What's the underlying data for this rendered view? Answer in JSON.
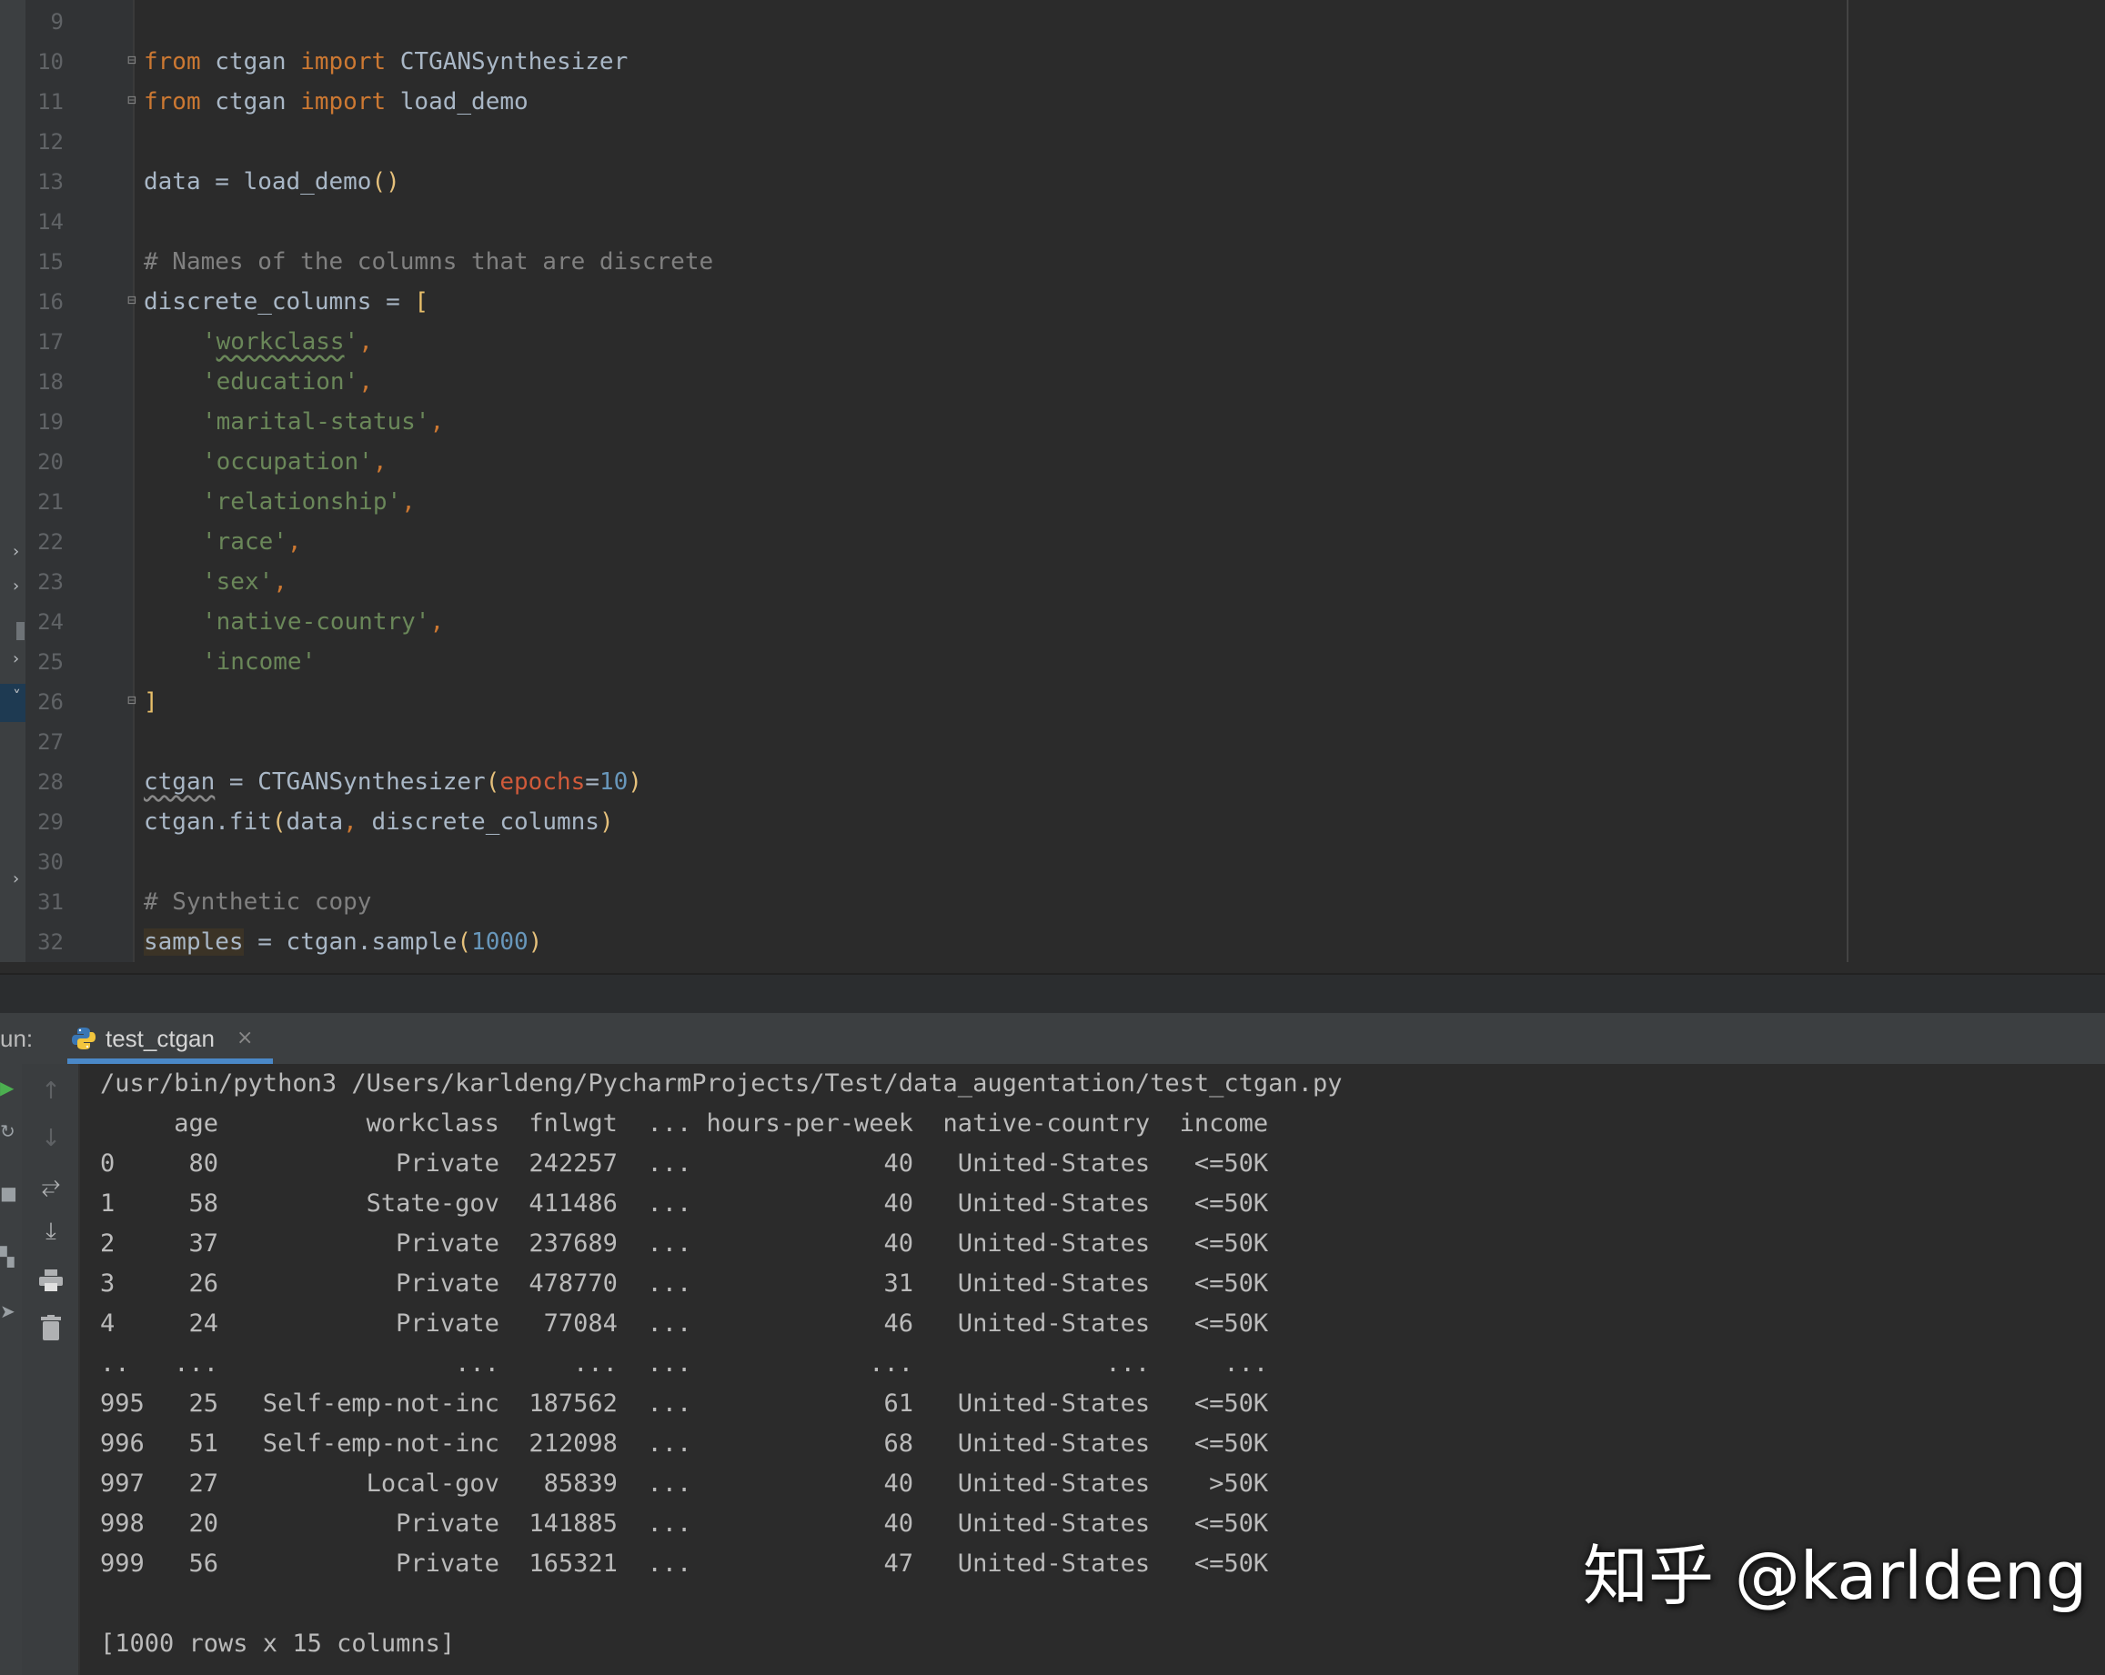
{
  "editor": {
    "line_numbers": [
      "9",
      "10",
      "11",
      "12",
      "13",
      "14",
      "15",
      "16",
      "17",
      "18",
      "19",
      "20",
      "21",
      "22",
      "23",
      "24",
      "25",
      "26",
      "27",
      "28",
      "29",
      "30",
      "31",
      "32"
    ],
    "lines": {
      "l10": {
        "kw1": "from",
        "mid1": " ctgan ",
        "kw2": "import",
        "rest": " CTGANSynthesizer"
      },
      "l11": {
        "kw1": "from",
        "mid1": " ctgan ",
        "kw2": "import",
        "rest": " load_demo"
      },
      "l13": {
        "text": "data = load_demo",
        "paren": "()"
      },
      "l15": {
        "comment": "# Names of the columns that are discrete"
      },
      "l16": {
        "text": "discrete_columns = ",
        "bracket": "["
      },
      "l17": {
        "q1": "'",
        "word": "workclass",
        "q2": "'",
        "comma": ","
      },
      "l18": {
        "str": "'education'",
        "comma": ","
      },
      "l19": {
        "str": "'marital-status'",
        "comma": ","
      },
      "l20": {
        "str": "'occupation'",
        "comma": ","
      },
      "l21": {
        "str": "'relationship'",
        "comma": ","
      },
      "l22": {
        "str": "'race'",
        "comma": ","
      },
      "l23": {
        "str": "'sex'",
        "comma": ","
      },
      "l24": {
        "str": "'native-country'",
        "comma": ","
      },
      "l25": {
        "str": "'income'"
      },
      "l26": {
        "bracket": "]"
      },
      "l28": {
        "var": "ctgan",
        "mid": " = CTGANSynthesizer",
        "p1": "(",
        "param": "epochs",
        "eq": "=",
        "num": "10",
        "p2": ")"
      },
      "l29": {
        "text": "ctgan.fit",
        "p1": "(",
        "args1": "data",
        "comma": ", ",
        "args2": "discrete_columns",
        "p2": ")"
      },
      "l31": {
        "comment": "# Synthetic copy"
      },
      "l32": {
        "var": "samples",
        "mid": " = ctgan.sample",
        "p1": "(",
        "num": "1000",
        "p2": ")"
      }
    }
  },
  "run": {
    "label": "un:",
    "tab_name": "test_ctgan",
    "tab_close": "×",
    "command": "/usr/bin/python3 /Users/karldeng/PycharmProjects/Test/data_augentation/test_ctgan.py",
    "table_header": "     age          workclass  fnlwgt  ... hours-per-week  native-country  income",
    "rows": [
      "0     80            Private  242257  ...             40   United-States   <=50K",
      "1     58          State-gov  411486  ...             40   United-States   <=50K",
      "2     37            Private  237689  ...             40   United-States   <=50K",
      "3     26            Private  478770  ...             31   United-States   <=50K",
      "4     24            Private   77084  ...             46   United-States   <=50K",
      "..   ...                ...     ...  ...            ...             ...     ...",
      "995   25   Self-emp-not-inc  187562  ...             61   United-States   <=50K",
      "996   51   Self-emp-not-inc  212098  ...             68   United-States   <=50K",
      "997   27          Local-gov   85839  ...             40   United-States    >50K",
      "998   20            Private  141885  ...             40   United-States   <=50K",
      "999   56            Private  165321  ...             47   United-States   <=50K"
    ],
    "summary": "[1000 rows x 15 columns]",
    "toolbar_icons": [
      "arrow-up-icon",
      "arrow-down-icon",
      "soft-wrap-icon",
      "scroll-to-end-icon",
      "print-icon",
      "trash-icon"
    ]
  },
  "watermark": "知乎 @karldeng",
  "colors": {
    "editor_bg": "#2b2b2b",
    "keyword": "#cc7832",
    "string": "#6a8759",
    "comment": "#808080",
    "number": "#6897bb",
    "text": "#a9b7c6",
    "param": "#d05a3a",
    "tab_underline": "#4a88c7"
  }
}
